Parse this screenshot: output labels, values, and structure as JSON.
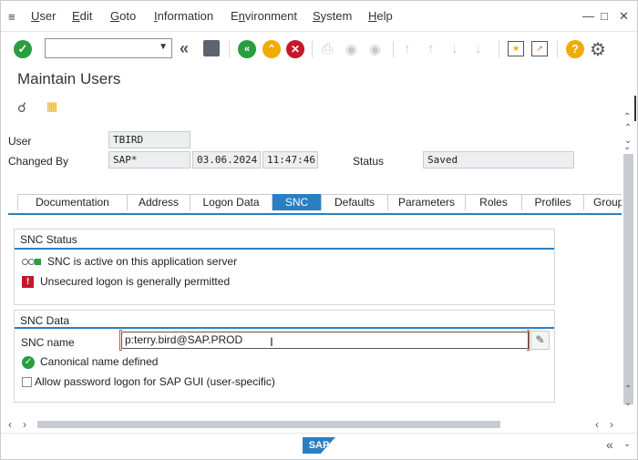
{
  "menu": {
    "items": [
      {
        "label": "User",
        "key": "U"
      },
      {
        "label": "Edit",
        "key": "E"
      },
      {
        "label": "Goto",
        "key": "G"
      },
      {
        "label": "Information",
        "key": "I"
      },
      {
        "label": "Environment",
        "key": "n"
      },
      {
        "label": "System",
        "key": "S"
      },
      {
        "label": "Help",
        "key": "H"
      }
    ],
    "icon": "menu-icon"
  },
  "toolbar": {
    "command_field": "",
    "icons": [
      "enter-icon",
      "save-icon",
      "back-icon",
      "exit-icon",
      "cancel-icon",
      "print-icon",
      "find-icon",
      "find-next-icon",
      "first-page-icon",
      "previous-page-icon",
      "next-page-icon",
      "last-page-icon",
      "new-session-icon",
      "shortcut-icon",
      "help-icon",
      "settings-icon"
    ]
  },
  "page": {
    "title": "Maintain Users"
  },
  "form": {
    "user_label": "User",
    "user_value": "TBIRD",
    "changed_by_label": "Changed By",
    "changed_by_value": "SAP*",
    "changed_date": "03.06.2024",
    "changed_time": "11:47:46",
    "status_label": "Status",
    "status_value": "Saved"
  },
  "tabs": [
    {
      "label": "Documentation",
      "active": false
    },
    {
      "label": "Address",
      "active": false
    },
    {
      "label": "Logon Data",
      "active": false
    },
    {
      "label": "SNC",
      "active": true
    },
    {
      "label": "Defaults",
      "active": false
    },
    {
      "label": "Parameters",
      "active": false
    },
    {
      "label": "Roles",
      "active": false
    },
    {
      "label": "Profiles",
      "active": false
    },
    {
      "label": "Group",
      "active": false
    }
  ],
  "snc_status": {
    "title": "SNC Status",
    "active_text": "SNC is active on this application server",
    "unsecured_text": "Unsecured logon is generally permitted"
  },
  "snc_data": {
    "title": "SNC Data",
    "name_label": "SNC name",
    "name_value": "p:terry.bird@SAP.PROD",
    "canonical_text": "Canonical name defined",
    "allow_password_text": "Allow password logon for SAP GUI (user-specific)",
    "allow_password_checked": false
  },
  "colors": {
    "accent": "#2b7ec1",
    "success": "#2a9d3e",
    "error": "#c6172b",
    "warning": "#f0ab00"
  },
  "footer": {
    "logo_text": "SAP"
  }
}
